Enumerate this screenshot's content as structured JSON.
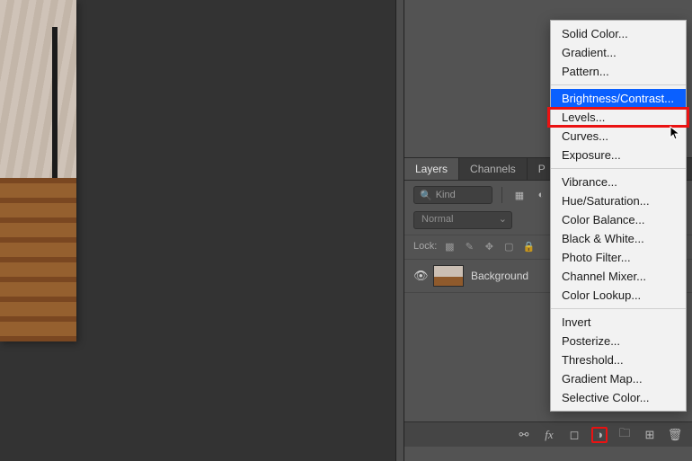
{
  "tabs": {
    "layers": "Layers",
    "channels": "Channels",
    "paths": "P"
  },
  "filter": {
    "kind_placeholder": "Kind"
  },
  "blend": {
    "mode": "Normal"
  },
  "lock": {
    "label": "Lock:"
  },
  "layer": {
    "name": "Background"
  },
  "ctx": {
    "solid_color": "Solid Color...",
    "gradient": "Gradient...",
    "pattern": "Pattern...",
    "brightness_contrast": "Brightness/Contrast...",
    "levels": "Levels...",
    "curves": "Curves...",
    "exposure": "Exposure...",
    "vibrance": "Vibrance...",
    "hue_saturation": "Hue/Saturation...",
    "color_balance": "Color Balance...",
    "black_white": "Black & White...",
    "photo_filter": "Photo Filter...",
    "channel_mixer": "Channel Mixer...",
    "color_lookup": "Color Lookup...",
    "invert": "Invert",
    "posterize": "Posterize...",
    "threshold": "Threshold...",
    "gradient_map": "Gradient Map...",
    "selective_color": "Selective Color..."
  }
}
